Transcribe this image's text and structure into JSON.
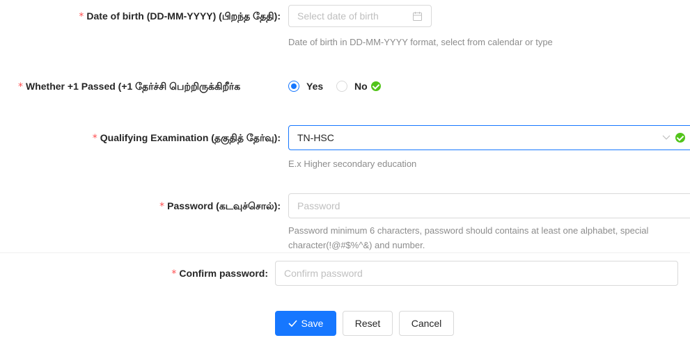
{
  "form": {
    "dob": {
      "label": "Date of birth (DD-MM-YYYY) (பிறந்த தேதி)",
      "placeholder": "Select date of birth",
      "help": "Date of birth in DD-MM-YYYY format, select from calendar or type"
    },
    "plus_one": {
      "label": "Whether +1 Passed (+1 தேர்ச்சி பெற்றிருக்கிறீர்க",
      "options": [
        "Yes",
        "No"
      ],
      "selected": "Yes"
    },
    "qualifying": {
      "label": "Qualifying Examination (தகுதித் தேர்வு)",
      "value": "TN-HSC",
      "help": "E.x Higher secondary education"
    },
    "password": {
      "label": "Password (கடவுச்சொல்)",
      "placeholder": "Password",
      "help_line1": "Password minimum 6 characters, password should contains at least one alphabet, special",
      "help_line2": "character(!@#$%^&) and number."
    },
    "confirm_password": {
      "label": "Confirm password",
      "placeholder": "Confirm password"
    },
    "required_mark": "*",
    "colon": ":"
  },
  "actions": {
    "save": "Save",
    "reset": "Reset",
    "cancel": "Cancel"
  },
  "colors": {
    "primary": "#1677ff",
    "required": "#ff4d4f",
    "success": "#52c41a"
  },
  "icons": [
    "calendar-icon",
    "success-check-icon",
    "chevron-down-icon",
    "checkmark-icon"
  ]
}
